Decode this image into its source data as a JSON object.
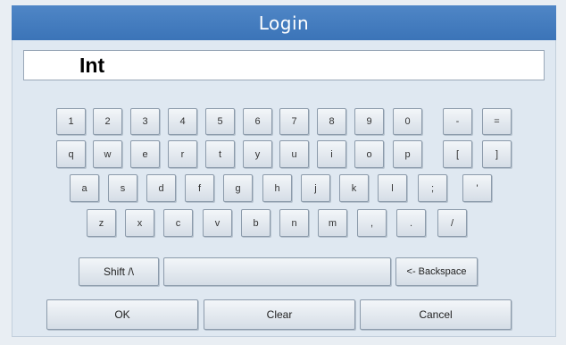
{
  "window": {
    "title": "Login"
  },
  "input": {
    "value": "Int"
  },
  "keyboard": {
    "row1": [
      "1",
      "2",
      "3",
      "4",
      "5",
      "6",
      "7",
      "8",
      "9",
      "0",
      "-",
      "="
    ],
    "row2": [
      "q",
      "w",
      "e",
      "r",
      "t",
      "y",
      "u",
      "i",
      "o",
      "p",
      "[",
      "]"
    ],
    "row3": [
      "a",
      "s",
      "d",
      "f",
      "g",
      "h",
      "j",
      "k",
      "l",
      ";",
      "'"
    ],
    "row4": [
      "z",
      "x",
      "c",
      "v",
      "b",
      "n",
      "m",
      ",",
      ".",
      "/"
    ],
    "shift_label": "Shift /\\",
    "space_label": "",
    "backspace_label": "<- Backspace"
  },
  "actions": {
    "ok_label": "OK",
    "clear_label": "Clear",
    "cancel_label": "Cancel"
  }
}
